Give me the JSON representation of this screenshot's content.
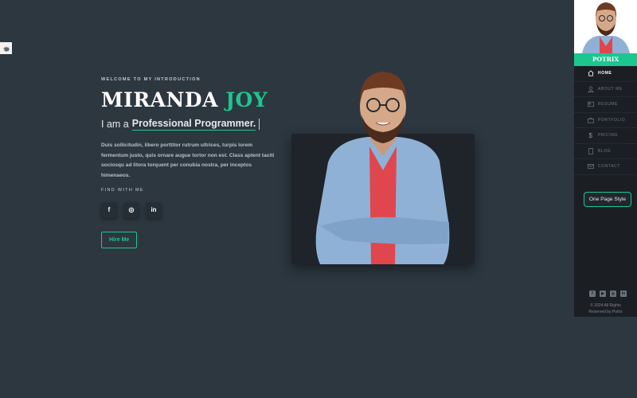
{
  "settings": {
    "icon": "gear-icon"
  },
  "intro": {
    "welcome": "WELCOME TO MY INTRODUCTION",
    "first_name": "MIRANDA",
    "last_name": "JOY",
    "role_prefix": "I am a",
    "role_typed": "Professional Programmer.",
    "description": "Duis sollicitudin, libero porttitor rutrum ultrices, turpis lorem fermentum justo, quis ornare augue tortor non est. Class aptent taciti sociosqu ad litora torquent per conubia nostra, per inceptos himenaeos.",
    "find_label": "FIND WITH ME",
    "socials": [
      {
        "name": "facebook",
        "glyph": "f"
      },
      {
        "name": "instagram",
        "glyph": "◎"
      },
      {
        "name": "linkedin",
        "glyph": "in"
      }
    ],
    "hire_label": "Hire Me"
  },
  "sidebar": {
    "brand": "POTRIX",
    "nav": [
      {
        "label": "HOME",
        "icon": "home-icon",
        "active": true
      },
      {
        "label": "ABOUT ME",
        "icon": "user-icon",
        "active": false
      },
      {
        "label": "RESUME",
        "icon": "resume-icon",
        "active": false
      },
      {
        "label": "PORTFOLIO",
        "icon": "briefcase-icon",
        "active": false
      },
      {
        "label": "PRICING",
        "icon": "dollar-icon",
        "active": false
      },
      {
        "label": "BLOG",
        "icon": "book-icon",
        "active": false
      },
      {
        "label": "CONTACT",
        "icon": "mail-icon",
        "active": false
      }
    ],
    "style_button": "One Page Style",
    "footer_socials": [
      "facebook",
      "youtube",
      "instagram",
      "linkedin"
    ],
    "copyright_line1": "© 2024 All Rights",
    "copyright_line2": "Reserved by Potrix"
  },
  "colors": {
    "accent": "#1dc68e",
    "background": "#2d3740",
    "sidebar": "#1b1f24"
  }
}
